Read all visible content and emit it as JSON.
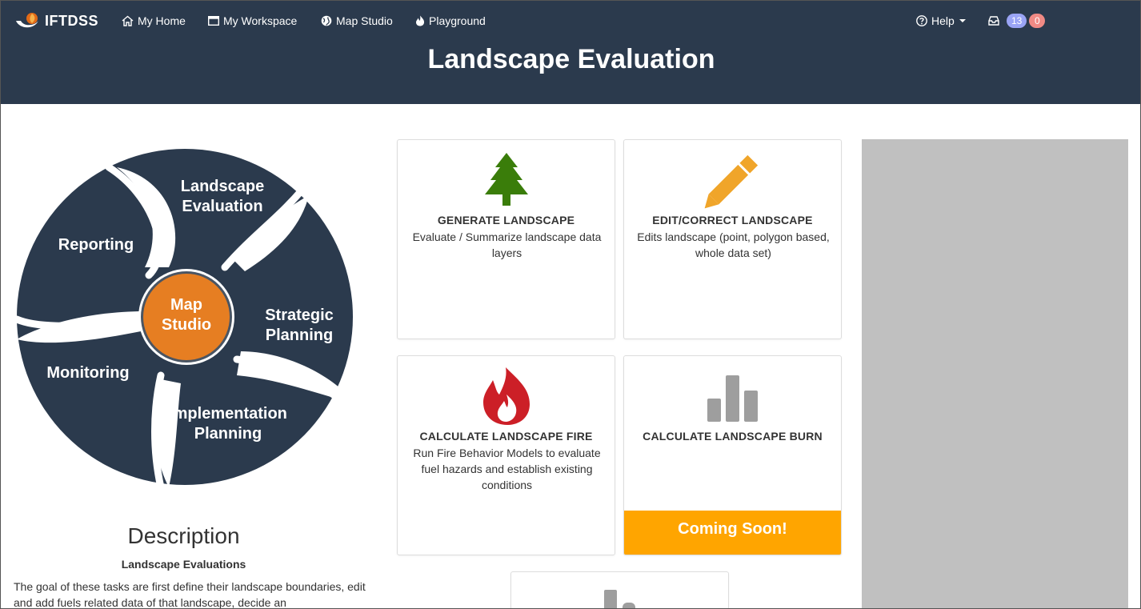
{
  "nav": {
    "brand": "IFTDSS",
    "links": [
      "My Home",
      "My Workspace",
      "Map Studio",
      "Playground"
    ],
    "help": "Help",
    "badge_blue": "13",
    "badge_red": "0"
  },
  "page_title": "Landscape Evaluation",
  "wheel": {
    "segments": [
      "Landscape Evaluation",
      "Strategic Planning",
      "Implementation Planning",
      "Monitoring",
      "Reporting"
    ],
    "center_line1": "Map",
    "center_line2": "Studio",
    "seg_lines": {
      "le1": "Landscape",
      "le2": "Evaluation",
      "sp1": "Strategic",
      "sp2": "Planning",
      "ip1": "Implementation",
      "ip2": "Planning",
      "mon": "Monitoring",
      "rep": "Reporting"
    }
  },
  "description": {
    "heading": "Description",
    "subheading": "Landscape Evaluations",
    "text": "The goal of these tasks are first define their landscape boundaries, edit and add fuels related data of that landscape, decide an"
  },
  "cards": [
    {
      "title": "GENERATE LANDSCAPE",
      "desc": "Evaluate / Summarize landscape data layers",
      "icon": "tree-icon"
    },
    {
      "title": "EDIT/CORRECT LANDSCAPE",
      "desc": "Edits landscape (point, polygon based, whole data set)",
      "icon": "pencil-icon"
    },
    {
      "title": "CALCULATE LANDSCAPE FIRE",
      "desc": "Run Fire Behavior Models to evaluate fuel hazards and establish existing conditions",
      "icon": "fire-icon"
    },
    {
      "title": "CALCULATE LANDSCAPE BURN",
      "desc": "",
      "icon": "bar-chart-icon",
      "status": "Coming Soon!"
    }
  ],
  "colors": {
    "header_bg": "#2b3a4d",
    "wheel": "#2b3a4d",
    "center": "#e67e22",
    "tree": "#3a7d0a",
    "pencil": "#f0a52a",
    "fire": "#cc1f27",
    "bars": "#9e9e9e",
    "coming_soon": "#ffa500",
    "badge_blue": "#9aa4f5",
    "badge_red": "#f08a85"
  }
}
